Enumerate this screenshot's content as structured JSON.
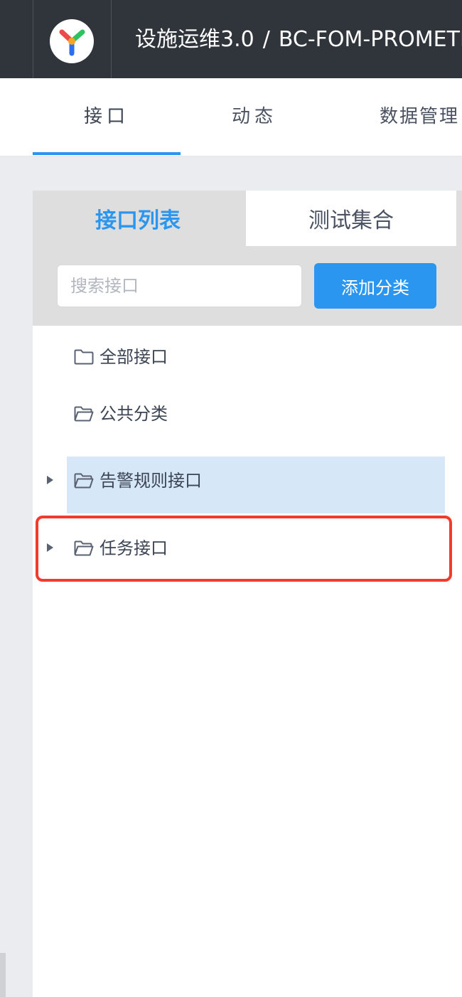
{
  "header": {
    "breadcrumb_project": "设施运维3.0",
    "breadcrumb_sep": "/",
    "breadcrumb_repo": "BC-FOM-PROMETHEUS"
  },
  "nav_tabs": [
    {
      "label": "接口",
      "active": true
    },
    {
      "label": "动态",
      "active": false
    },
    {
      "label": "数据管理",
      "active": false
    }
  ],
  "sub_tabs": [
    {
      "label": "接口列表",
      "active": true
    },
    {
      "label": "测试集合",
      "active": false
    }
  ],
  "search": {
    "placeholder": "搜索接口",
    "value": ""
  },
  "add_category_label": "添加分类",
  "tree": {
    "all": "全部接口",
    "public": "公共分类",
    "categories": [
      {
        "label": "告警规则接口",
        "selected": true
      },
      {
        "label": "任务接口",
        "selected": false
      }
    ]
  },
  "colors": {
    "accent": "#2b96f0",
    "topbar": "#30353c",
    "selected": "#d6e8f8",
    "highlight": "#f23b2a"
  }
}
